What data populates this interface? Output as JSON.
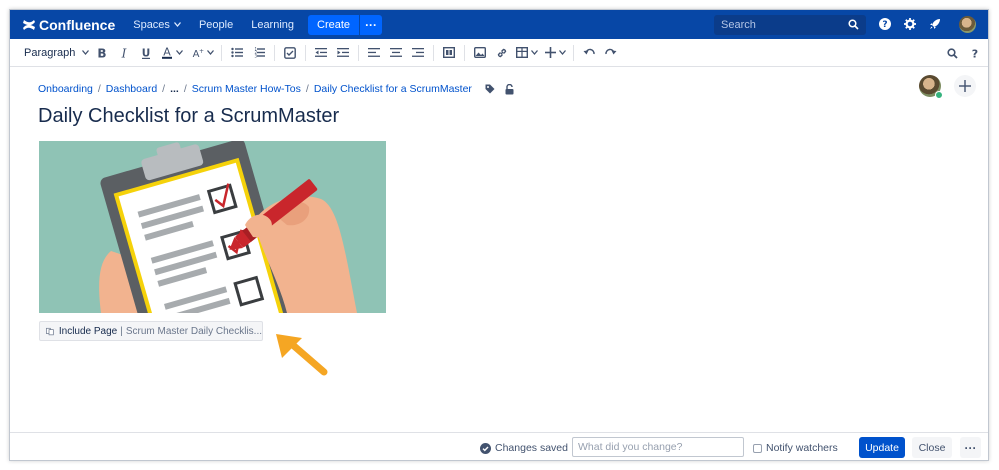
{
  "colors": {
    "nav_bg": "#0747a6",
    "create_btn": "#0065ff",
    "link": "#0052cc",
    "update_btn": "#0052cc",
    "illustration_bg": "#8fc3b5",
    "arrow": "#f5a623"
  },
  "topnav": {
    "logo_text": "Confluence",
    "spaces_label": "Spaces",
    "people_label": "People",
    "learning_label": "Learning",
    "create_label": "Create",
    "create_more_label": "···",
    "search_placeholder": "Search",
    "icons": [
      "confluence-logo-icon",
      "search-icon",
      "help-icon",
      "gear-icon",
      "rocket-icon",
      "user-avatar"
    ]
  },
  "toolbar": {
    "paragraph_label": "Paragraph",
    "icons": [
      "bold-icon",
      "italic-icon",
      "underline-icon",
      "text-color-icon",
      "text-format-icon",
      "bullet-list-icon",
      "numbered-list-icon",
      "task-list-icon",
      "outdent-icon",
      "indent-icon",
      "align-left-icon",
      "align-center-icon",
      "align-right-icon",
      "layout-icon",
      "image-icon",
      "link-icon",
      "table-icon",
      "insert-icon",
      "undo-icon",
      "redo-icon",
      "find-icon",
      "help-icon"
    ]
  },
  "breadcrumb": {
    "items": [
      "Onboarding",
      "Dashboard",
      "...",
      "Scrum Master How-Tos",
      "Daily Checklist for a ScrumMaster"
    ],
    "separator": "/"
  },
  "page": {
    "title": "Daily Checklist for a ScrumMaster"
  },
  "macro": {
    "name": "Include Page",
    "separator": "|",
    "param": "Scrum Master Daily Checklis..."
  },
  "footer": {
    "status": "Changes saved",
    "change_placeholder": "What did you change?",
    "notify_label": "Notify watchers",
    "update_label": "Update",
    "close_label": "Close",
    "more_label": "···"
  }
}
